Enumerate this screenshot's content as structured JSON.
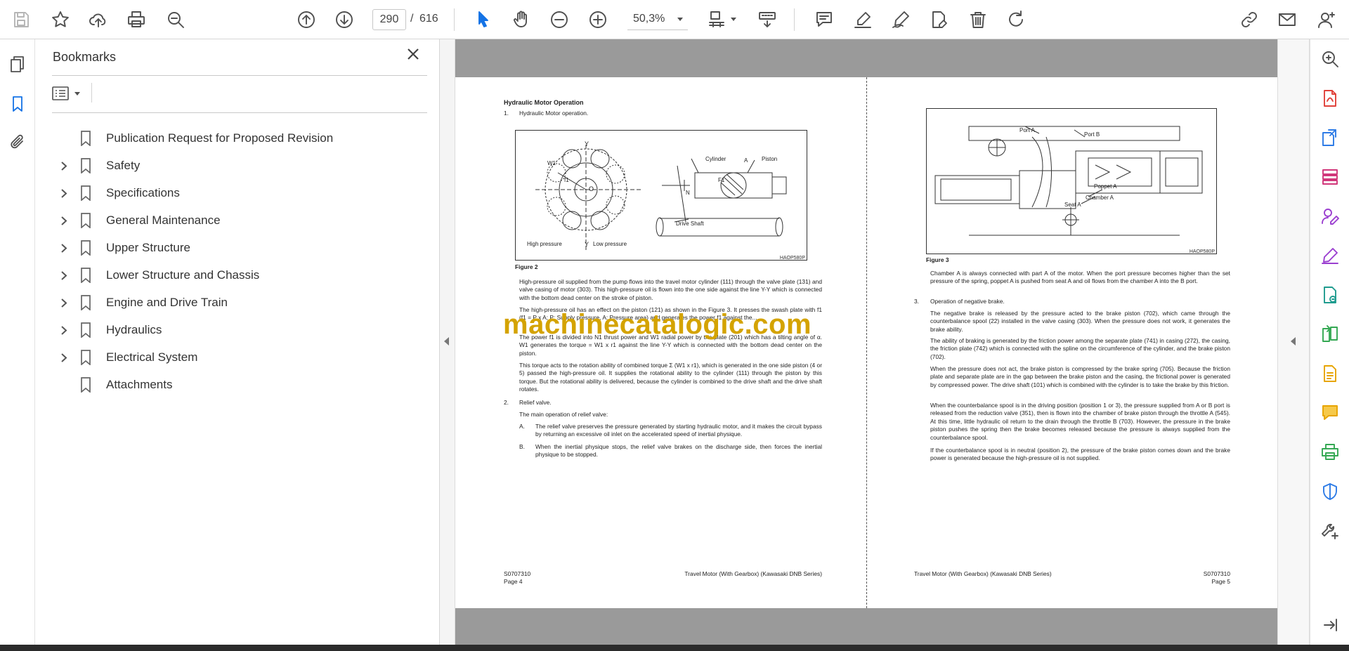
{
  "toolbar": {
    "page_current": "290",
    "page_separator": "/",
    "page_total": "616",
    "zoom": "50,3%"
  },
  "bookmarks": {
    "title": "Bookmarks",
    "items": [
      {
        "label": "Publication Request for Proposed Revision",
        "expandable": false
      },
      {
        "label": "Safety",
        "expandable": true
      },
      {
        "label": "Specifications",
        "expandable": true
      },
      {
        "label": "General Maintenance",
        "expandable": true
      },
      {
        "label": "Upper Structure",
        "expandable": true
      },
      {
        "label": "Lower Structure and Chassis",
        "expandable": true
      },
      {
        "label": "Engine and Drive Train",
        "expandable": true
      },
      {
        "label": "Hydraulics",
        "expandable": true
      },
      {
        "label": "Electrical System",
        "expandable": true
      },
      {
        "label": "Attachments",
        "expandable": false
      }
    ]
  },
  "watermark": "machinecatalogic.com",
  "left_page": {
    "heading": "Hydraulic Motor Operation",
    "item1_num": "1.",
    "item1": "Hydraulic Motor operation.",
    "figure_labels": {
      "y_top": "Y",
      "y_bottom": "Y",
      "w1": "W1",
      "f1": "f1",
      "o": "O",
      "cylinder": "Cylinder",
      "a": "A",
      "piston": "Piston",
      "fa": "F1",
      "n": "N",
      "drive_shaft": "Drive Shaft",
      "high_pressure": "High pressure",
      "low_pressure": "Low pressure"
    },
    "figure_code": "HAOP580P",
    "figure_caption": "Figure 2",
    "p1": "High-pressure oil supplied from the pump flows into the travel motor cylinder (111) through the valve plate (131) and valve casing of motor (303). This high-pressure oil is flown into the one side against the line Y-Y which is connected with the bottom dead center on the stroke of piston.",
    "p2": "The high-pressure oil has an effect on the piston (121) as shown in the Figure 3. It presses the swash plate with f1 (f1 = P x A; P: Supply pressure, A: Pressure area) and generates the power f1 against the...",
    "p3": "The power f1 is divided into N1 thrust power and W1 radial power by the plate (201) which has a tilting angle of α. W1 generates the torque = W1 x r1 against the line Y-Y which is connected with the bottom dead center on the piston.",
    "p4": "This torque acts to the rotation ability of combined torque Σ (W1 x r1), which is generated in the one side piston (4 or 5) passed the high-pressure oil. It supplies the rotational ability to the cylinder (111) through the piston by this torque. But the rotational ability is delivered, because the cylinder is combined to the drive shaft and the drive shaft rotates.",
    "item2_num": "2.",
    "item2": "Relief valve.",
    "item2_sub": "The main operation of relief valve:",
    "itemA_num": "A.",
    "itemA": "The relief valve preserves the pressure generated by starting hydraulic motor, and it makes the circuit bypass by returning an excessive oil inlet on the accelerated speed of inertial physique.",
    "itemB_num": "B.",
    "itemB": "When the inertial physique stops, the relief valve brakes on the discharge side, then forces the inertial physique to be stopped.",
    "footer_code": "S0707310",
    "footer_page": "Page 4",
    "footer_title": "Travel Motor (With Gearbox) (Kawasaki DNB Series)"
  },
  "right_page": {
    "figure_labels": {
      "port_a": "Port A",
      "port_b": "Port B",
      "poppet_a": "Poppet A",
      "chamber_a": "Chamber A",
      "seat_a": "Seat A"
    },
    "figure_code": "HAOP580P",
    "figure_caption": "Figure 3",
    "p1": "Chamber A is always connected with part A of the motor. When the port pressure becomes higher than the set pressure of the spring, poppet A is pushed from seat A and oil flows from the chamber A into the B port.",
    "item3_num": "3.",
    "item3": "Operation of negative brake.",
    "p2": "The negative brake is released by the pressure acted to the brake piston (702), which came through the counterbalance spool (22) installed in the valve casing (303). When the pressure does not work, it generates the brake ability.",
    "p3": "The ability of braking is generated by the friction power among the separate plate (741) in casing (272), the casing, the friction plate (742) which is connected with the spline on the circumference of the cylinder, and the brake piston (702).",
    "p4": "When the pressure does not act, the brake piston is compressed by the brake spring (705). Because the friction plate and separate plate are in the gap between the brake piston and the casing, the frictional power is generated by compressed power. The drive shaft (101) which is combined with the cylinder is to take the brake by this friction.",
    "p5": "When the counterbalance spool is in the driving position (position 1 or 3), the pressure supplied from A or B port is released from the reduction valve (351), then is flown into the chamber of brake piston through the throttle A (545). At this time, little hydraulic oil return to the drain through the throttle B (703). However, the pressure in the brake piston pushes the spring then the brake becomes released because the pressure is always supplied from the counterbalance spool.",
    "p6": "If the counterbalance spool is in neutral (position 2), the pressure of the brake piston comes down and the brake power is generated because the high-pressure oil is not supplied.",
    "footer_title": "Travel Motor (With Gearbox) (Kawasaki DNB Series)",
    "footer_code": "S0707310",
    "footer_page": "Page 5"
  }
}
